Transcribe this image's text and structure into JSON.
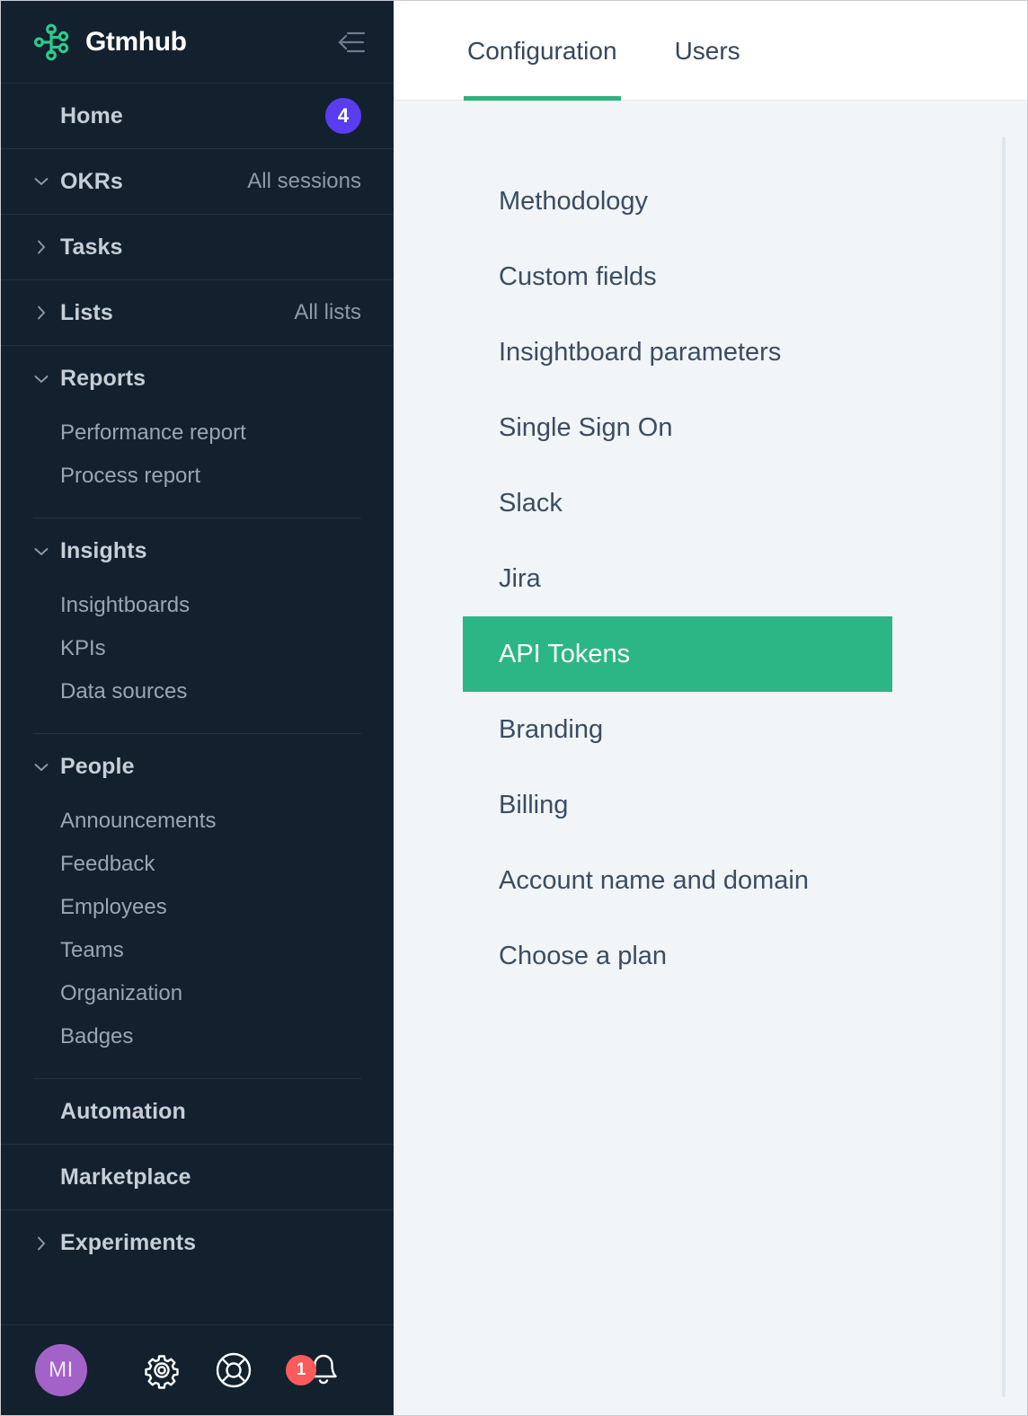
{
  "sidebar": {
    "brand": {
      "name": "Gtmhub",
      "logo_icon": "gtmhub-node-graph-logo",
      "logo_color": "#2ec98a"
    },
    "collapse_icon": "collapse-sidebar-icon",
    "home": {
      "label": "Home",
      "badge": "4",
      "badge_color": "#5a3df0"
    },
    "groups": [
      {
        "label": "OKRs",
        "chevron": "chevron-down-icon",
        "aside": "All sessions",
        "children": []
      },
      {
        "label": "Tasks",
        "chevron": "chevron-right-icon",
        "aside": "",
        "children": []
      },
      {
        "label": "Lists",
        "chevron": "chevron-right-icon",
        "aside": "All lists",
        "children": []
      },
      {
        "label": "Reports",
        "chevron": "chevron-down-icon",
        "aside": "",
        "children": [
          "Performance report",
          "Process report"
        ]
      },
      {
        "label": "Insights",
        "chevron": "chevron-down-icon",
        "aside": "",
        "children": [
          "Insightboards",
          "KPIs",
          "Data sources"
        ]
      },
      {
        "label": "People",
        "chevron": "chevron-down-icon",
        "aside": "",
        "children": [
          "Announcements",
          "Feedback",
          "Employees",
          "Teams",
          "Organization",
          "Badges"
        ]
      },
      {
        "label": "Automation",
        "chevron": "",
        "aside": "",
        "children": []
      },
      {
        "label": "Marketplace",
        "chevron": "",
        "aside": "",
        "children": []
      },
      {
        "label": "Experiments",
        "chevron": "chevron-right-icon",
        "aside": "",
        "children": []
      }
    ],
    "footer": {
      "avatar_initials": "MI",
      "avatar_color": "#a362c8",
      "settings_icon": "gear-icon",
      "help_icon": "life-ring-icon",
      "notifications_icon": "bell-icon",
      "notifications_count": "1",
      "notifications_badge_color": "#fb5b5b"
    }
  },
  "main": {
    "tabs": [
      {
        "label": "Configuration",
        "active": true
      },
      {
        "label": "Users",
        "active": false
      }
    ],
    "active_tab_underline_color": "#2cb37e",
    "selected_item_color": "#2cb685",
    "config_items": [
      {
        "label": "Methodology",
        "selected": false
      },
      {
        "label": "Custom fields",
        "selected": false
      },
      {
        "label": "Insightboard parameters",
        "selected": false
      },
      {
        "label": "Single Sign On",
        "selected": false
      },
      {
        "label": "Slack",
        "selected": false
      },
      {
        "label": "Jira",
        "selected": false
      },
      {
        "label": "API Tokens",
        "selected": true
      },
      {
        "label": "Branding",
        "selected": false
      },
      {
        "label": "Billing",
        "selected": false
      },
      {
        "label": "Account name and domain",
        "selected": false
      },
      {
        "label": "Choose a plan",
        "selected": false
      }
    ]
  }
}
